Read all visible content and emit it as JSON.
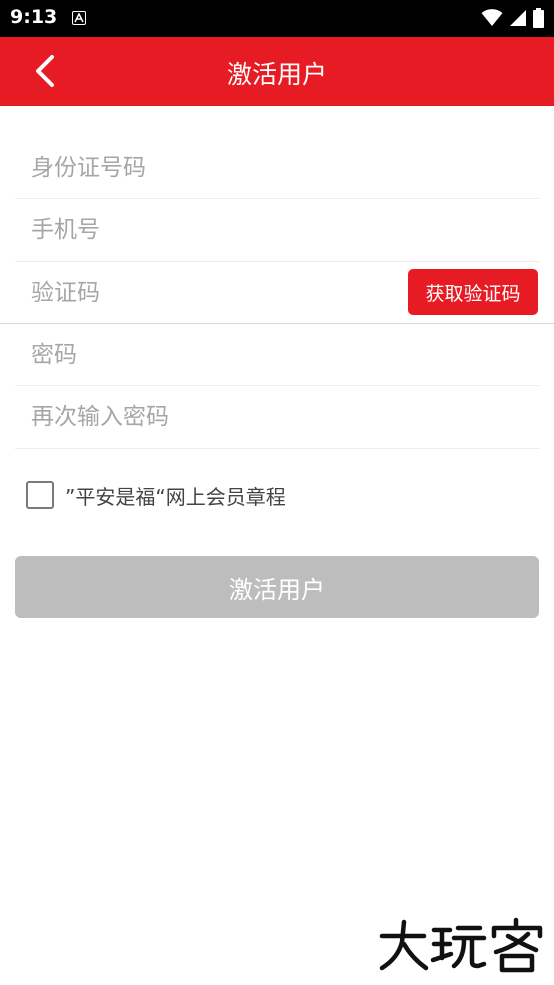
{
  "status_bar": {
    "time": "9:13",
    "icons": [
      "a-notification-icon",
      "wifi-icon",
      "signal-icon",
      "battery-icon"
    ]
  },
  "header": {
    "title": "激活用户",
    "back_icon": "chevron-left-icon"
  },
  "form": {
    "id_number": {
      "placeholder": "身份证号码",
      "value": ""
    },
    "phone": {
      "placeholder": "手机号",
      "value": ""
    },
    "verification_code": {
      "placeholder": "验证码",
      "value": ""
    },
    "get_code_button": "获取验证码",
    "password": {
      "placeholder": "密码",
      "value": ""
    },
    "confirm_password": {
      "placeholder": "再次输入密码",
      "value": ""
    },
    "agreement_checked": false,
    "agreement_text": "”平安是福“网上会员章程",
    "submit_button": "激活用户"
  },
  "colors": {
    "accent": "#e71b23",
    "disabled_button": "#bdbdbd",
    "placeholder": "#a6a6a6",
    "status_bar": "#000000"
  },
  "watermark_text": "大玩客"
}
